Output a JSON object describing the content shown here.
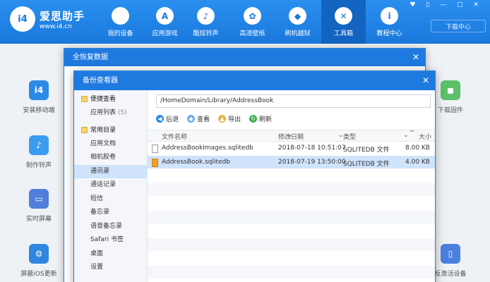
{
  "app": {
    "brand": "爱思助手",
    "url": "www.i4.cn",
    "logo": "i4",
    "download_center": "下载中心",
    "window_controls": "♥ ▯ — ▢ ✕"
  },
  "nav": [
    {
      "label": "我的设备",
      "icon": "apple-icon",
      "glyph": ""
    },
    {
      "label": "应用游戏",
      "icon": "app-store-icon",
      "glyph": "A"
    },
    {
      "label": "酷炫铃声",
      "icon": "bell-icon",
      "glyph": "♪"
    },
    {
      "label": "高清壁纸",
      "icon": "flower-icon",
      "glyph": "✿"
    },
    {
      "label": "刷机越狱",
      "icon": "dropbox-icon",
      "glyph": "◆"
    },
    {
      "label": "工具箱",
      "icon": "tools-icon",
      "glyph": "✕"
    },
    {
      "label": "教程中心",
      "icon": "info-icon",
      "glyph": "i"
    }
  ],
  "tools_left": [
    {
      "label": "安装移动端",
      "icon": "i4-app-icon",
      "color": "#2b8ae6",
      "glyph": "i4"
    },
    {
      "label": "制作铃声",
      "icon": "bell-icon",
      "color": "#3b9cf0",
      "glyph": "♪"
    },
    {
      "label": "实时屏幕",
      "icon": "monitor-icon",
      "color": "#4f7fd8",
      "glyph": "▭"
    },
    {
      "label": "屏蔽iOS更新",
      "icon": "gear-icon",
      "color": "#2f86e0",
      "glyph": "⚙"
    }
  ],
  "tools_right": [
    {
      "label": "下载固件",
      "icon": "cube-icon",
      "color": "#5cc06a",
      "glyph": "◼"
    },
    {
      "label": "反激活设备",
      "icon": "device-icon",
      "color": "#4a7fe0",
      "glyph": "▯"
    }
  ],
  "dialog_back": {
    "title": "全恢复数据",
    "close": "✕"
  },
  "dialog_front": {
    "title": "备份查看器",
    "close": "✕"
  },
  "sidebar": {
    "sections": [
      {
        "title": "便捷查看",
        "items": [
          {
            "label": "应用列表",
            "count": "(5)"
          }
        ]
      },
      {
        "title": "常用目录",
        "items": [
          {
            "label": "应用文档"
          },
          {
            "label": "相机胶卷"
          },
          {
            "label": "通讯录",
            "selected": true
          },
          {
            "label": "通话记录"
          },
          {
            "label": "短信"
          },
          {
            "label": "备忘录"
          },
          {
            "label": "语音备忘录"
          },
          {
            "label": "Safari 书签"
          },
          {
            "label": "桌面"
          },
          {
            "label": "设置"
          }
        ]
      }
    ]
  },
  "path": "/HomeDomain/Library/AddressBook",
  "actions": [
    {
      "label": "后退",
      "icon": "back-arrow-icon",
      "color": "#2b8ae6",
      "glyph": "◀"
    },
    {
      "label": "查看",
      "icon": "view-icon",
      "color": "#6aa8e8",
      "glyph": "◉"
    },
    {
      "label": "导出",
      "icon": "export-folder-icon",
      "color": "#e8b44a",
      "glyph": "▲"
    },
    {
      "label": "刷新",
      "icon": "refresh-icon",
      "color": "#3fb24e",
      "glyph": "↻"
    }
  ],
  "columns": {
    "name": "文件名称",
    "modified": "修改日期",
    "type": "类型",
    "size": "大小",
    "sort_indicator": "⌄",
    "sort_up": "^"
  },
  "files": [
    {
      "name": "AddressBookImages.sqlitedb",
      "modified": "2018-07-18 10:51:07",
      "type": "SQLITEDB 文件",
      "size": "8.00 KB",
      "icon": "file-icon",
      "selected": false
    },
    {
      "name": "AddressBook.sqlitedb",
      "modified": "2018-07-19 13:50:00",
      "type": "SQLITEDB 文件",
      "size": "4.00 KB",
      "icon": "database-file-icon",
      "selected": true
    }
  ]
}
